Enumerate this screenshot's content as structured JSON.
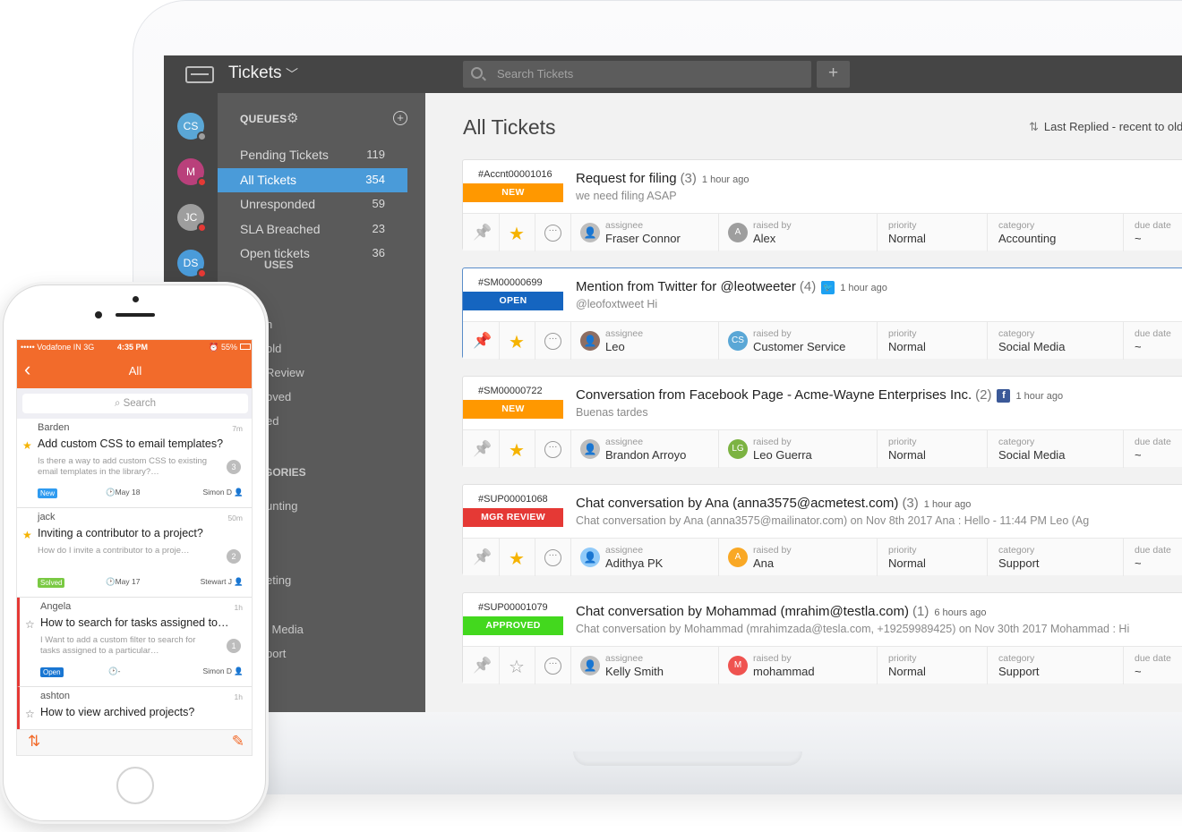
{
  "app": {
    "title": "Tickets",
    "search_placeholder": "Search Tickets",
    "add_label": "+"
  },
  "agents": [
    {
      "initials": "CS",
      "bg": "#5aa7d6",
      "status": "#9e9e9e"
    },
    {
      "initials": "M",
      "bg": "#b9407b",
      "status": "#e53935"
    },
    {
      "initials": "JC",
      "bg": "#9e9e9e",
      "status": "#e53935"
    },
    {
      "initials": "DS",
      "bg": "#4a9bd9",
      "status": "#e53935"
    }
  ],
  "queues": {
    "heading": "QUEUES",
    "items": [
      {
        "label": "Pending Tickets",
        "count": "119"
      },
      {
        "label": "All Tickets",
        "count": "354"
      },
      {
        "label": "Unresponded",
        "count": "59"
      },
      {
        "label": "SLA Breached",
        "count": "23"
      },
      {
        "label": "Open tickets",
        "count": "36"
      }
    ],
    "partial_under_phone": [
      "USES",
      "n",
      "old",
      "Review",
      "oved",
      "ed",
      "GORIES",
      "unting",
      "eting",
      "l Media",
      "port"
    ]
  },
  "main": {
    "title": "All Tickets",
    "sort_label": "Last Replied - recent to olde",
    "field_labels": {
      "assignee": "assignee",
      "raised_by": "raised by",
      "priority": "priority",
      "category": "category",
      "due_date": "due date"
    },
    "tickets": [
      {
        "id": "#Accnt00001016",
        "status": "NEW",
        "status_color": "#ff9800",
        "subject": "Request for filing",
        "count": "(3)",
        "ago": "1 hour ago",
        "network": "",
        "snippet": "we need filing ASAP",
        "assignee": "Fraser Connor",
        "assignee_initial": "",
        "assignee_color": "#bdbdbd",
        "raised_by": "Alex",
        "raised_initial": "A",
        "raised_color": "#9e9e9e",
        "priority": "Normal",
        "category": "Accounting",
        "due": "~",
        "pinned": false,
        "starred": true,
        "selected": false
      },
      {
        "id": "#SM00000699",
        "status": "OPEN",
        "status_color": "#1565c0",
        "subject": "Mention from Twitter for @leotweeter",
        "count": "(4)",
        "ago": "1 hour ago",
        "network": "twitter",
        "snippet": "@leofoxtweet Hi",
        "assignee": "Leo",
        "assignee_initial": "",
        "assignee_color": "#8d6e63",
        "raised_by": "Customer Service",
        "raised_initial": "CS",
        "raised_color": "#5aa7d6",
        "priority": "Normal",
        "category": "Social Media",
        "due": "~",
        "pinned": true,
        "starred": true,
        "selected": true
      },
      {
        "id": "#SM00000722",
        "status": "NEW",
        "status_color": "#ff9800",
        "subject": "Conversation from Facebook Page - Acme-Wayne Enterprises Inc.",
        "count": "(2)",
        "ago": "1 hour ago",
        "network": "facebook",
        "snippet": "Buenas tardes",
        "assignee": "Brandon Arroyo",
        "assignee_initial": "",
        "assignee_color": "#bdbdbd",
        "raised_by": "Leo Guerra",
        "raised_initial": "LG",
        "raised_color": "#7cb342",
        "priority": "Normal",
        "category": "Social Media",
        "due": "~",
        "pinned": false,
        "starred": true,
        "selected": false
      },
      {
        "id": "#SUP00001068",
        "status": "MGR REVIEW",
        "status_color": "#e53935",
        "subject": "Chat conversation by Ana (anna3575@acmetest.com)",
        "count": "(3)",
        "ago": "1 hour ago",
        "network": "",
        "snippet": "Chat conversation by Ana (anna3575@mailinator.com) on Nov 8th 2017 Ana : Hello - 11:44 PM Leo (Ag",
        "assignee": "Adithya PK",
        "assignee_initial": "",
        "assignee_color": "#90caf9",
        "raised_by": "Ana",
        "raised_initial": "A",
        "raised_color": "#f9a825",
        "priority": "Normal",
        "category": "Support",
        "due": "~",
        "pinned": false,
        "starred": true,
        "selected": false
      },
      {
        "id": "#SUP00001079",
        "status": "APPROVED",
        "status_color": "#43d81e",
        "subject": "Chat conversation by Mohammad (mrahim@testla.com)",
        "count": "(1)",
        "ago": "6 hours ago",
        "network": "",
        "snippet": "Chat conversation by Mohammad (mrahimzada@tesla.com, +19259989425) on Nov 30th 2017 Mohammad : Hi",
        "assignee": "Kelly Smith",
        "assignee_initial": "",
        "assignee_color": "#bdbdbd",
        "raised_by": "mohammad",
        "raised_initial": "M",
        "raised_color": "#ef5350",
        "priority": "Normal",
        "category": "Support",
        "due": "~",
        "pinned": false,
        "starred": false,
        "selected": false
      }
    ]
  },
  "phone": {
    "carrier": "••••• Vodafone IN  3G",
    "time": "4:35 PM",
    "battery": "⏰ 55%",
    "nav_title": "All",
    "search_placeholder": "Search",
    "items": [
      {
        "name": "Barden",
        "time": "7m",
        "subject": "Add custom CSS to email templates?",
        "snippet": "Is there a way to add custom CSS to existing email templates in the library?…",
        "count": "3",
        "badge": "New",
        "badge_color": "#2f9bf0",
        "date": "May 18",
        "user": "Simon D",
        "starred": true,
        "urgent": false
      },
      {
        "name": "jack",
        "time": "50m",
        "subject": "Inviting a contributor to a project?",
        "snippet": "How do I invite a contributor to a proje…",
        "count": "2",
        "badge": "Solved",
        "badge_color": "#7ac943",
        "date": "May 17",
        "user": "Stewart J",
        "starred": true,
        "urgent": false
      },
      {
        "name": "Angela",
        "time": "1h",
        "subject": "How to search for tasks assigned to…",
        "snippet": "I Want to add a custom filter to search for tasks assigned to a particular…",
        "count": "1",
        "badge": "Open",
        "badge_color": "#1976d2",
        "date": "-",
        "user": "Simon D",
        "starred": false,
        "urgent": true
      },
      {
        "name": "ashton",
        "time": "1h",
        "subject": "How to view archived projects?",
        "snippet": "",
        "count": "",
        "badge": "",
        "badge_color": "",
        "date": "",
        "user": "",
        "starred": false,
        "urgent": true
      }
    ]
  }
}
